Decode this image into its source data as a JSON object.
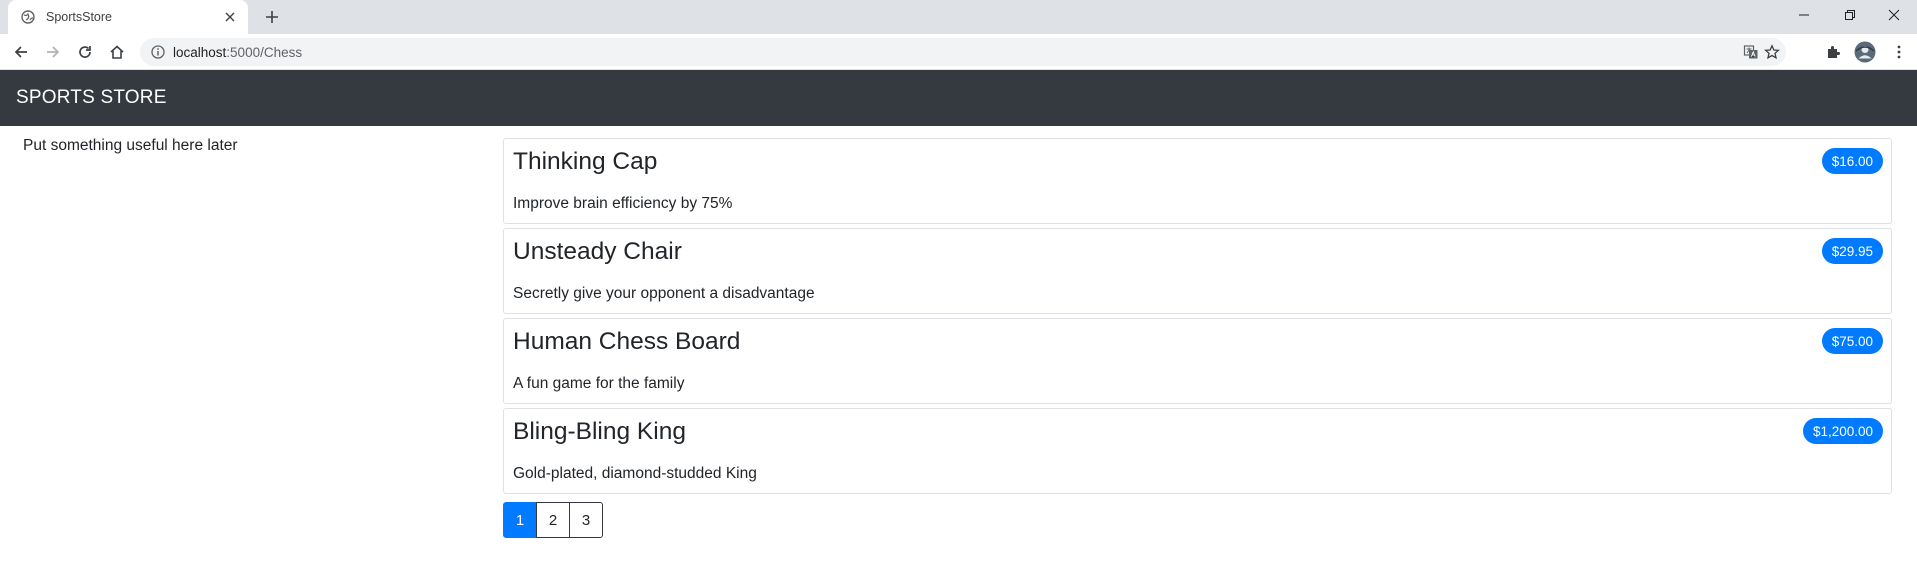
{
  "browser": {
    "tab_title": "SportsStore",
    "url_host": "localhost",
    "url_rest": ":5000/Chess"
  },
  "page": {
    "brand": "SPORTS STORE",
    "sidebar_note": "Put something useful here later",
    "products": [
      {
        "name": "Thinking Cap",
        "description": "Improve brain efficiency by 75%",
        "price": "$16.00"
      },
      {
        "name": "Unsteady Chair",
        "description": "Secretly give your opponent a disadvantage",
        "price": "$29.95"
      },
      {
        "name": "Human Chess Board",
        "description": "A fun game for the family",
        "price": "$75.00"
      },
      {
        "name": "Bling-Bling King",
        "description": "Gold-plated, diamond-studded King",
        "price": "$1,200.00"
      }
    ],
    "pagination": {
      "pages": [
        "1",
        "2",
        "3"
      ],
      "active": "1"
    }
  },
  "colors": {
    "navbar": "#343a40",
    "accent": "#007bff"
  },
  "icons": [
    "globe-icon",
    "close-icon",
    "plus-icon",
    "minimize-icon",
    "restore-icon",
    "back-icon",
    "forward-icon",
    "reload-icon",
    "home-icon",
    "info-icon",
    "translate-icon",
    "star-icon",
    "extensions-icon",
    "avatar",
    "more-icon"
  ]
}
